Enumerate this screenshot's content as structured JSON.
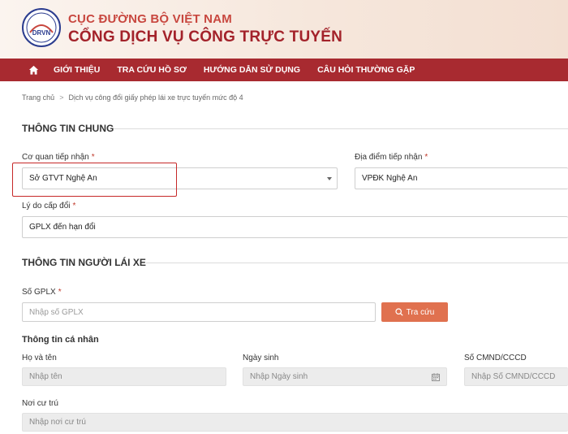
{
  "header": {
    "logo_text": "DRVN",
    "org_name": "CỤC ĐƯỜNG BỘ VIỆT NAM",
    "portal_name": "CỔNG DỊCH VỤ CÔNG TRỰC TUYẾN"
  },
  "nav": {
    "items": [
      {
        "label": "GIỚI THIỆU"
      },
      {
        "label": "TRA CỨU HỒ SƠ"
      },
      {
        "label": "HƯỚNG DẪN SỬ DỤNG"
      },
      {
        "label": "CÂU HỎI THƯỜNG GẶP"
      }
    ]
  },
  "breadcrumb": {
    "home": "Trang chủ",
    "separator": ">",
    "current": "Dịch vụ công đổi giấy phép lái xe trực tuyến mức độ 4"
  },
  "general_info": {
    "title": "THÔNG TIN CHUNG",
    "receiving_agency": {
      "label": "Cơ quan tiếp nhận",
      "required_mark": "*",
      "value": "Sở GTVT Nghệ An"
    },
    "receiving_location": {
      "label": "Địa điểm tiếp nhận",
      "required_mark": "*",
      "value": "VPĐK Nghệ An"
    },
    "reason": {
      "label": "Lý do cấp đổi",
      "required_mark": "*",
      "value": "GPLX đến hạn đổi"
    }
  },
  "driver_info": {
    "title": "THÔNG TIN NGƯỜI LÁI XE",
    "license_no": {
      "label": "Số GPLX",
      "required_mark": "*",
      "placeholder": "Nhập số GPLX"
    },
    "search_button": "Tra cứu",
    "personal_title": "Thông tin cá nhân",
    "full_name": {
      "label": "Họ và tên",
      "placeholder": "Nhập tên"
    },
    "dob": {
      "label": "Ngày sinh",
      "placeholder": "Nhập Ngày sinh"
    },
    "id_number": {
      "label": "Số CMND/CCCD",
      "placeholder": "Nhập Số CMND/CCCD"
    },
    "residence": {
      "label": "Nơi cư trú",
      "placeholder": "Nhập nơi cư trú"
    }
  },
  "colors": {
    "brand_red": "#a82a30",
    "accent_orange": "#e0714f",
    "highlight_red": "#c62828"
  }
}
